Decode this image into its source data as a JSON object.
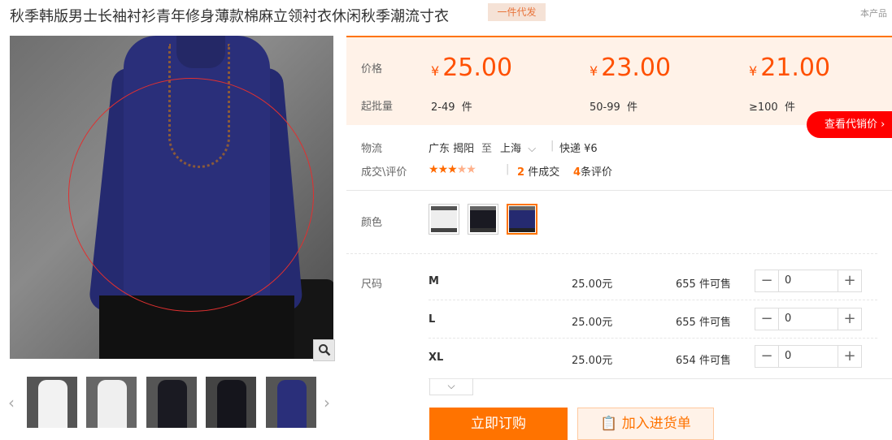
{
  "product": {
    "title": "秋季韩版男士长袖衬衫青年修身薄款棉麻立领衬衣休闲秋季潮流寸衣",
    "badge": "一件代发",
    "top_right": "本产品"
  },
  "pricing": {
    "price_label": "价格",
    "moq_label": "起批量",
    "currency": "¥",
    "unit": "件",
    "tiers": [
      {
        "price": "25.00",
        "range": "2-49"
      },
      {
        "price": "23.00",
        "range": "50-99"
      },
      {
        "price": "21.00",
        "range": "≥100"
      }
    ],
    "agent_price_button": "查看代销价"
  },
  "logistics": {
    "label": "物流",
    "origin": "广东 揭阳",
    "to": "至",
    "destination": "上海",
    "shipping": "快递 ¥6"
  },
  "deals": {
    "label": "成交\\评价",
    "rating": 3,
    "max_rating": 5,
    "transactions_count": "2",
    "transactions_text": "件成交",
    "reviews_count": "4",
    "reviews_text": "条评价"
  },
  "color": {
    "label": "颜色",
    "selected_index": 2,
    "accent": "#ff7300"
  },
  "size": {
    "label": "尺码",
    "rows": [
      {
        "name": "M",
        "price": "25.00元",
        "stock": "655 件可售",
        "qty": "0"
      },
      {
        "name": "L",
        "price": "25.00元",
        "stock": "655 件可售",
        "qty": "0"
      },
      {
        "name": "XL",
        "price": "25.00元",
        "stock": "654 件可售",
        "qty": "0"
      }
    ]
  },
  "actions": {
    "buy_now": "立即订购",
    "add_to_cart": "加入进货单"
  },
  "colors": {
    "brand_orange": "#ff7300",
    "price_red": "#ff5000",
    "promo_red": "#ff0000"
  }
}
